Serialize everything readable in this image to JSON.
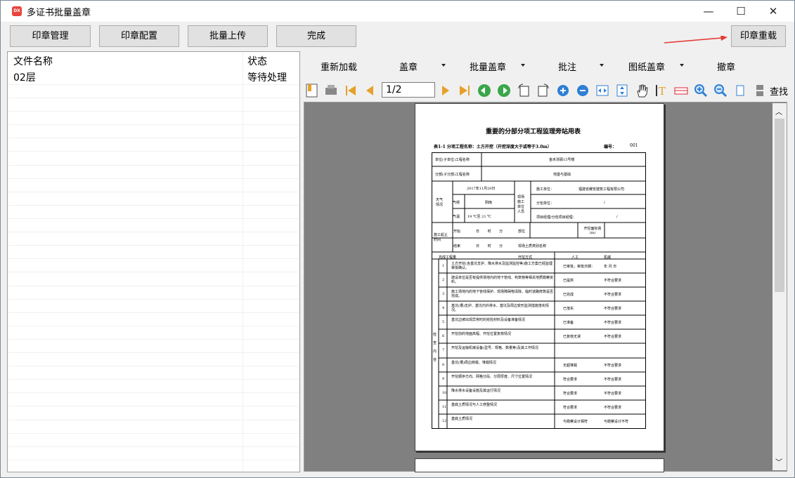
{
  "window": {
    "title": "多证书批量盖章",
    "minimize": "—",
    "maximize": "☐",
    "close": "✕"
  },
  "buttons": {
    "seal_manage": "印章管理",
    "seal_config": "印章配置",
    "batch_upload": "批量上传",
    "finish": "完成",
    "seal_reload": "印章重载"
  },
  "file_list": {
    "col_name": "文件名称",
    "col_status": "状态",
    "rows": [
      {
        "name": "02层",
        "status": "等待处理"
      }
    ]
  },
  "menu": {
    "reload": "重新加载",
    "seal": "盖章",
    "batch_seal": "批量盖章",
    "annotate": "批注",
    "drawing_seal": "图纸盖章",
    "revoke": "撤章"
  },
  "toolbar": {
    "page_value": "1/2",
    "search_label": "查找"
  },
  "document": {
    "title": "重要的分部分项工程监理旁站用表",
    "subtitle": "表1-1 分项工程名称：土方开挖（开挖深度大于或等于3.0m）",
    "number_label": "编号：",
    "number": "001",
    "unit_label": "单位(子单位)工程名称",
    "unit_value": "金禾浙驿15号楼",
    "part_label": "分部(子分部)工程名称",
    "part_value": "地基与基础",
    "date": "2017年11月20日",
    "weather_label": "天气情况",
    "climate_label": "气候",
    "climate": "阴雨",
    "temp_label": "气温",
    "temp": "19 ℃至 21 ℃",
    "site_label": "现场施工单位人员",
    "contractor_label": "施工单位：",
    "contractor": "福建省耀安建筑工程有限公司",
    "sub_label": "分包单位：",
    "sub_value": "/",
    "pm_label": "项目经理/分包项目经理：",
    "pm_value": "/",
    "time_label": "施工起止时间",
    "start_label": "开始",
    "end_label": "结束",
    "dt_units": "日 时 分",
    "location_label": "部位",
    "elev_label": "开挖面标高(m)",
    "soil_label": "现场土质类别名称",
    "work_label": "完成工程量",
    "method_label": "开挖方式",
    "manual": "人工",
    "machine": "机械",
    "check_label": "检查内容",
    "items": [
      {
        "n": "1",
        "text": "土方开挖(含基坑支护、降水排水及监测监控等)施工方案已经监理审批确认。",
        "opt1": "已审批，审批日期：",
        "opt2": "年 月 日"
      },
      {
        "n": "2",
        "text": "建设单位是否有提供场地内的地下管线、构筑物等相关地质勘察资料。",
        "opt1": "已提供",
        "opt2": "不符合要求"
      },
      {
        "n": "3",
        "text": "施工场地内的地下管线保护、现场障碍物清除、临时道路修筑是否完成。",
        "opt1": "已完成",
        "opt2": "不符合要求"
      },
      {
        "n": "4",
        "text": "基坑(槽)支护、基坑内外排水、基坑及周边变形监测措施落实情况。",
        "opt1": "已落实",
        "opt2": "不符合要求"
      },
      {
        "n": "5",
        "text": "基坑边坡出现异常时的抢险材料及设备准备情况",
        "opt1": "已准备",
        "opt2": "不符合要求"
      },
      {
        "n": "6",
        "text": "开挖前的地面高程、开挖位置复核情况",
        "opt1": "已复核无误",
        "opt2": "不符合要求"
      },
      {
        "n": "7",
        "text": "开挖及运输机械设备(型号、规格、数量等)及其工作情况",
        "opt1": "",
        "opt2": ""
      },
      {
        "n": "8",
        "text": "基坑(槽)周边荷载、堆载情况",
        "opt1": "无超堆载",
        "opt2": "不符合要求"
      },
      {
        "n": "9",
        "text": "开挖顺序方向、网格分段、分层厚度、尺寸位置情况",
        "opt1": "符合要求",
        "opt2": "不符合要求"
      },
      {
        "n": "10",
        "text": "降水排水设备设施及其运行情况",
        "opt1": "符合要求",
        "opt2": "不符合要求"
      },
      {
        "n": "11",
        "text": "基底土质情况与人工修整情况",
        "opt1": "符合要求",
        "opt2": "不符合要求"
      },
      {
        "n": "12",
        "text": "基底土质情况",
        "opt1": "与勘察设计相符",
        "opt2": "与勘察设计不符"
      }
    ]
  }
}
